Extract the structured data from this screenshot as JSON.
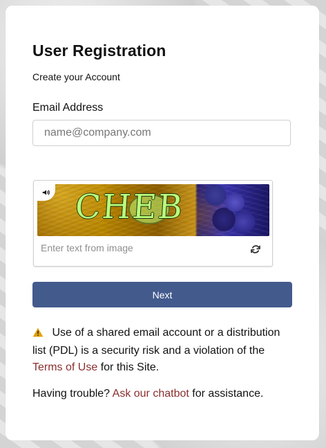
{
  "page": {
    "title": "User Registration",
    "subtitle": "Create your Account"
  },
  "email": {
    "label": "Email Address",
    "placeholder": "name@company.com"
  },
  "captcha": {
    "text": "CHEB",
    "input_placeholder": "Enter text from image",
    "speaker_icon": "speaker-icon",
    "refresh_icon": "refresh-icon"
  },
  "actions": {
    "next_label": "Next"
  },
  "notice": {
    "icon": "warning-icon",
    "text_before": "Use of a shared email account or a distribution list (PDL) is a security risk and a violation of the ",
    "terms_link": "Terms of Use",
    "text_after": " for this Site."
  },
  "help": {
    "prefix": "Having trouble? ",
    "link": "Ask our chatbot",
    "suffix": " for assistance."
  },
  "colors": {
    "primary_button": "#435a8d",
    "link": "#8a2f2f",
    "card_background": "#ffffff"
  }
}
